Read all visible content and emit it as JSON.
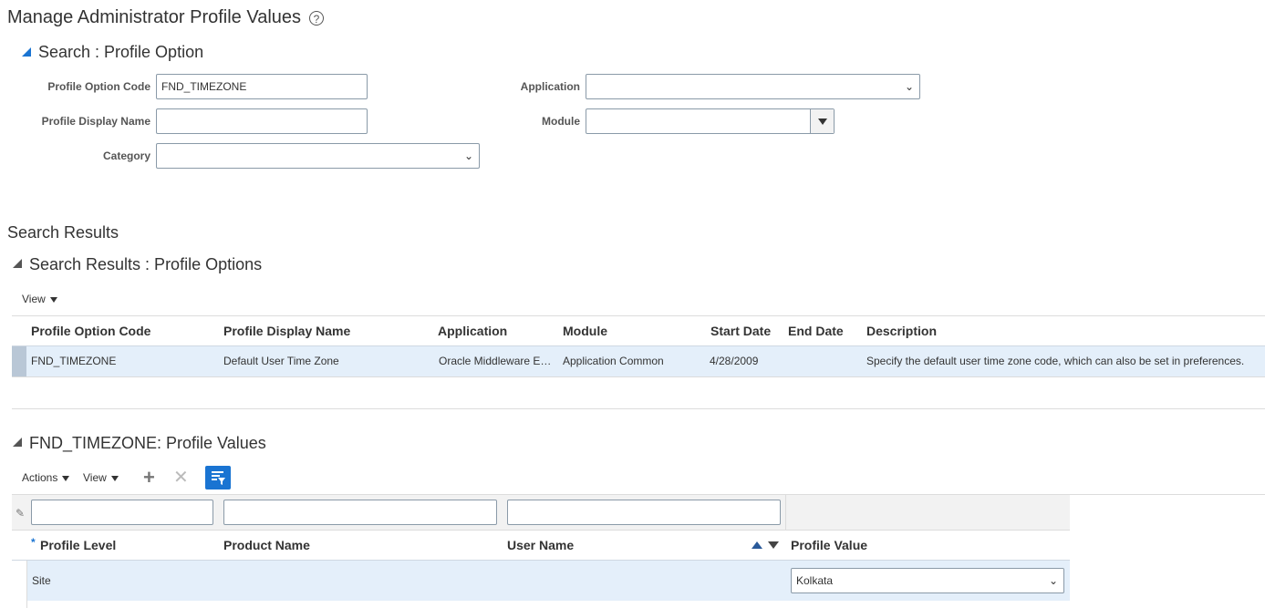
{
  "page": {
    "title": "Manage Administrator Profile Values",
    "help_icon": "?"
  },
  "search": {
    "header": "Search : Profile Option",
    "fields": {
      "profile_option_code": {
        "label": "Profile Option Code",
        "value": "FND_TIMEZONE"
      },
      "profile_display_name": {
        "label": "Profile Display Name",
        "value": ""
      },
      "category": {
        "label": "Category",
        "value": ""
      },
      "application": {
        "label": "Application",
        "value": ""
      },
      "module": {
        "label": "Module",
        "value": ""
      }
    },
    "chevron": "⌄"
  },
  "results": {
    "title": "Search Results",
    "panel_header": "Search Results : Profile Options",
    "view_menu": "View",
    "columns": [
      "Profile Option Code",
      "Profile Display Name",
      "Application",
      "Module",
      "Start Date",
      "End Date",
      "Description"
    ],
    "rows": [
      {
        "code": "FND_TIMEZONE",
        "display_name": "Default User Time Zone",
        "application": "Oracle Middleware Extensions for Applications",
        "module": "Application Common",
        "start_date": "4/28/2009",
        "end_date": "",
        "description": "Specify the default user time zone code, which can also be set in preferences."
      }
    ]
  },
  "values": {
    "header": "FND_TIMEZONE: Profile Values",
    "actions_menu": "Actions",
    "view_menu": "View",
    "add_icon": "+",
    "remove_icon": "✕",
    "required_marker": "*",
    "columns": [
      "Profile Level",
      "Product Name",
      "User Name",
      "Profile Value"
    ],
    "rows": [
      {
        "level": "Site",
        "product": "",
        "user": "",
        "value": "Kolkata"
      }
    ]
  },
  "colors": {
    "accent": "#1a74d2",
    "selected_row": "#e4effa"
  }
}
